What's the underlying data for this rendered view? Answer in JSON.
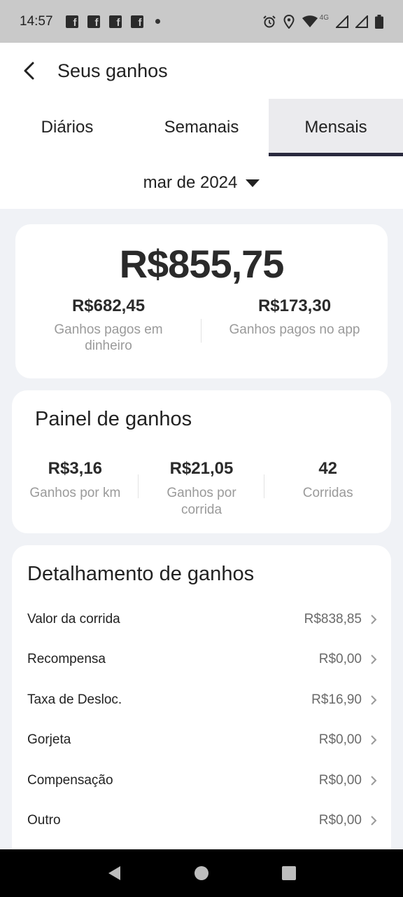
{
  "status_bar": {
    "time": "14:57",
    "network": "4G",
    "notification_icons": [
      "facebook-icon",
      "facebook-icon",
      "facebook-icon",
      "facebook-icon"
    ]
  },
  "header": {
    "title": "Seus ganhos"
  },
  "tabs": [
    {
      "label": "Diários",
      "active": false
    },
    {
      "label": "Semanais",
      "active": false
    },
    {
      "label": "Mensais",
      "active": true
    }
  ],
  "period": {
    "label": "mar de 2024"
  },
  "summary": {
    "total": "R$855,75",
    "cash": {
      "value": "R$682,45",
      "label": "Ganhos pagos em dinheiro"
    },
    "app": {
      "value": "R$173,30",
      "label": "Ganhos pagos no app"
    }
  },
  "panel": {
    "title": "Painel de ganhos",
    "stats": [
      {
        "value": "R$3,16",
        "label": "Ganhos por km"
      },
      {
        "value": "R$21,05",
        "label": "Ganhos por corrida"
      },
      {
        "value": "42",
        "label": "Corridas"
      }
    ]
  },
  "breakdown": {
    "title": "Detalhamento de ganhos",
    "rows": [
      {
        "label": "Valor da corrida",
        "value": "R$838,85"
      },
      {
        "label": "Recompensa",
        "value": "R$0,00"
      },
      {
        "label": "Taxa de Desloc.",
        "value": "R$16,90"
      },
      {
        "label": "Gorjeta",
        "value": "R$0,00"
      },
      {
        "label": "Compensação",
        "value": "R$0,00"
      },
      {
        "label": "Outro",
        "value": "R$0,00"
      }
    ]
  },
  "colors": {
    "accent": "#2a2a3e",
    "background": "#f0f2f6",
    "muted_text": "#9a9a9a"
  }
}
